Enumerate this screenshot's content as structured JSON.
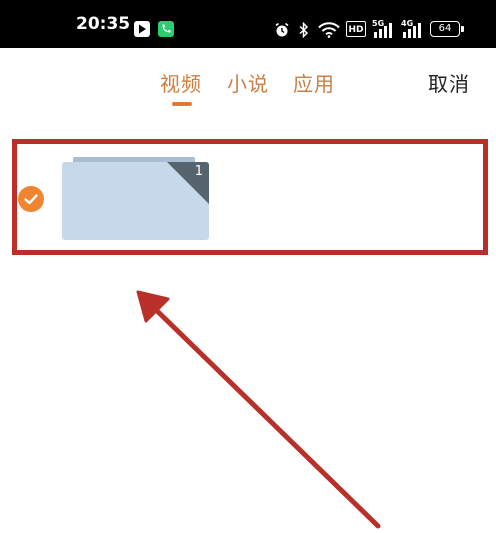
{
  "status_bar": {
    "time": "20:35",
    "network_5g": "5G",
    "network_4g": "4G",
    "hd_badge": "HD",
    "battery": "64"
  },
  "tabs": [
    {
      "label": "视频",
      "active": true
    },
    {
      "label": "小说",
      "active": false
    },
    {
      "label": "应用",
      "active": false
    }
  ],
  "cancel_label": "取消",
  "items": [
    {
      "count": "1",
      "selected": true
    }
  ],
  "colors": {
    "accent": "#ee8530",
    "tab_text": "#c7804a",
    "folder": "#c7d8eb",
    "annotation": "#b9302a"
  }
}
